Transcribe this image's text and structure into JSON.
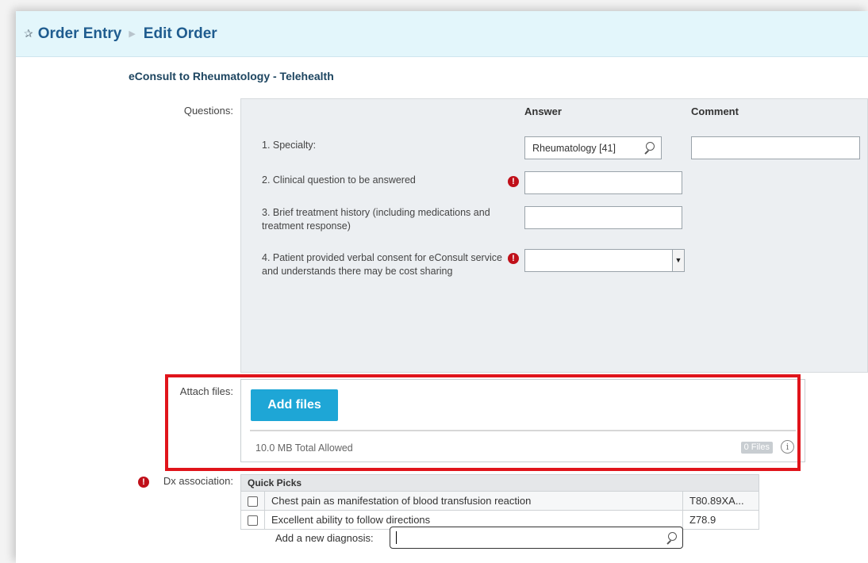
{
  "header": {
    "crumb_1": "Order Entry",
    "crumb_2": "Edit Order"
  },
  "order": {
    "title": "eConsult to Rheumatology - Telehealth"
  },
  "questions": {
    "label": "Questions:",
    "answer_header": "Answer",
    "comment_header": "Comment",
    "items": [
      {
        "text": "1. Specialty:",
        "answer": "Rheumatology [41]",
        "required": false
      },
      {
        "text": "2. Clinical question to be answered",
        "answer": "",
        "required": true
      },
      {
        "text": "3. Brief treatment history (including medications and treatment response)",
        "answer": "",
        "required": false
      },
      {
        "text": "4. Patient provided verbal consent for eConsult service and understands there may be cost sharing",
        "answer": "",
        "required": true
      }
    ]
  },
  "attach": {
    "label": "Attach files:",
    "button": "Add files",
    "limit": "10.0 MB Total Allowed",
    "file_count": "0 Files",
    "info_glyph": "i"
  },
  "dx": {
    "label": "Dx association:",
    "table_header": "Quick Picks",
    "rows": [
      {
        "name": "Chest pain as manifestation of blood transfusion reaction",
        "code": "T80.89XA...",
        "checked": false
      },
      {
        "name": "Excellent ability to follow directions",
        "code": "Z78.9",
        "checked": false
      }
    ],
    "new_label": "Add a new diagnosis:",
    "new_value": ""
  },
  "icons": {
    "pin": "✰",
    "breadcrumb_sep": "▶",
    "required": "!",
    "dropdown": "▼"
  },
  "colors": {
    "header_bg": "#e3f6fb",
    "crumb_text": "#1f5c8f",
    "button_bg": "#1ea6d6",
    "required_red": "#c0101a",
    "highlight_red": "#e0141b"
  }
}
